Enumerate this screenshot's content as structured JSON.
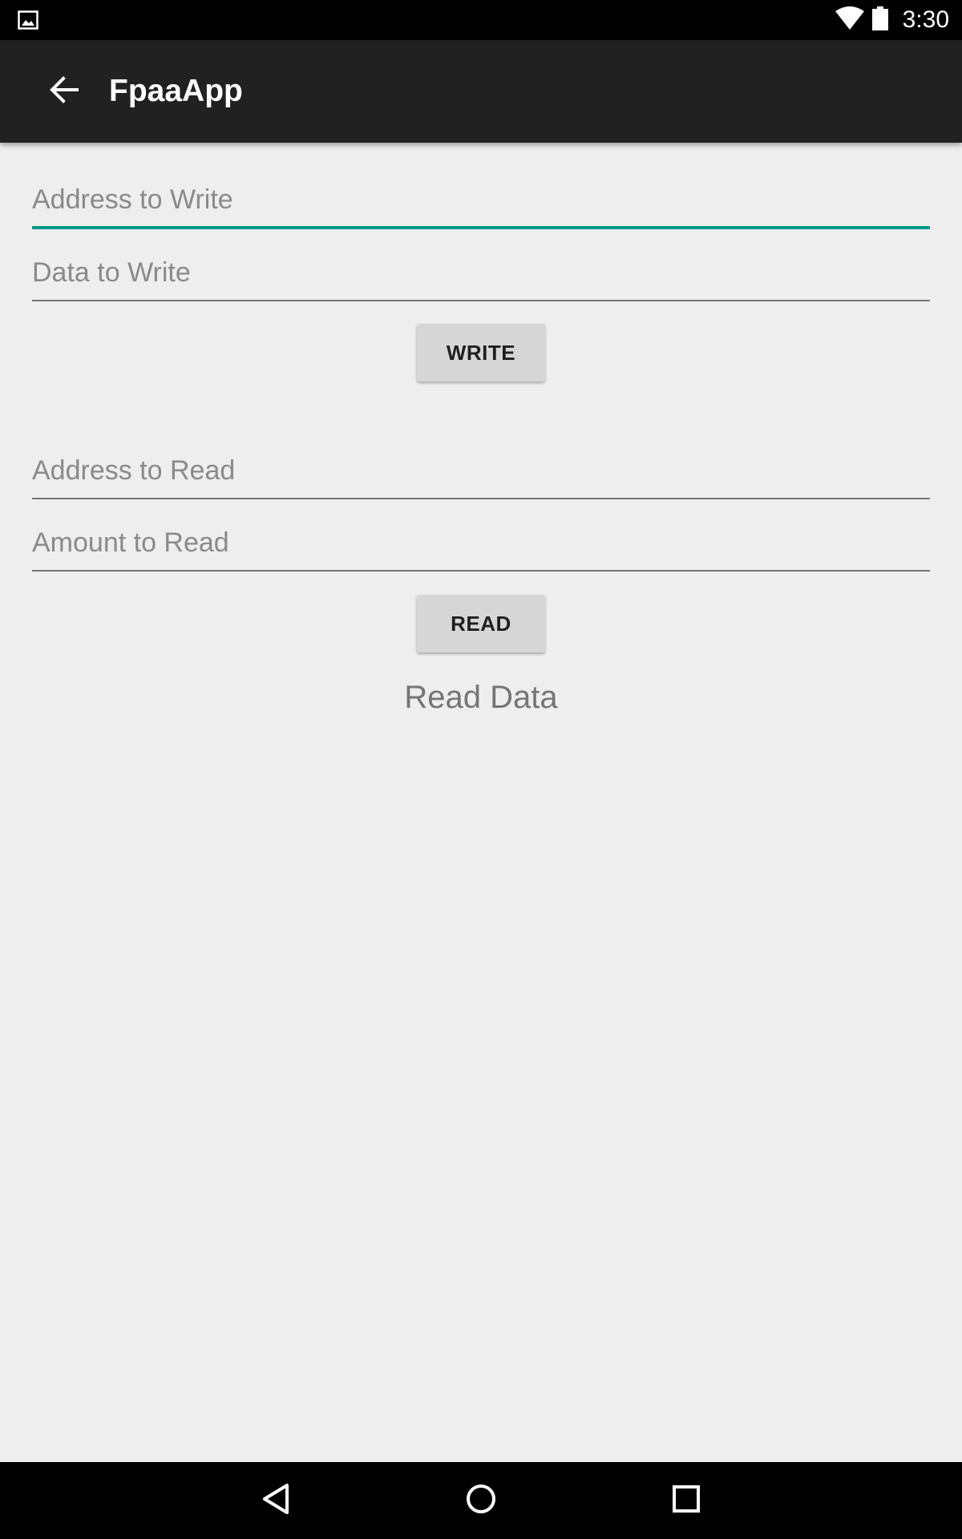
{
  "status_bar": {
    "time": "3:30",
    "icons": [
      "image-notification-icon",
      "wifi-icon",
      "battery-icon"
    ]
  },
  "app_bar": {
    "title": "FpaaApp",
    "back_icon": "back-arrow-icon"
  },
  "write_section": {
    "address_placeholder": "Address to Write",
    "data_placeholder": "Data to Write",
    "button_label": "WRITE"
  },
  "read_section": {
    "address_placeholder": "Address to Read",
    "amount_placeholder": "Amount to Read",
    "button_label": "READ",
    "result_text": "Read Data"
  },
  "nav_bar": {
    "icons": [
      "back-nav-icon",
      "home-nav-icon",
      "recents-nav-icon"
    ]
  },
  "colors": {
    "status_bar": "#000000",
    "app_bar": "#212121",
    "background": "#EEEEEE",
    "accent": "#009688",
    "button": "#D6D6D6",
    "hint_text": "#8a8a8a",
    "nav_bar": "#000000"
  }
}
